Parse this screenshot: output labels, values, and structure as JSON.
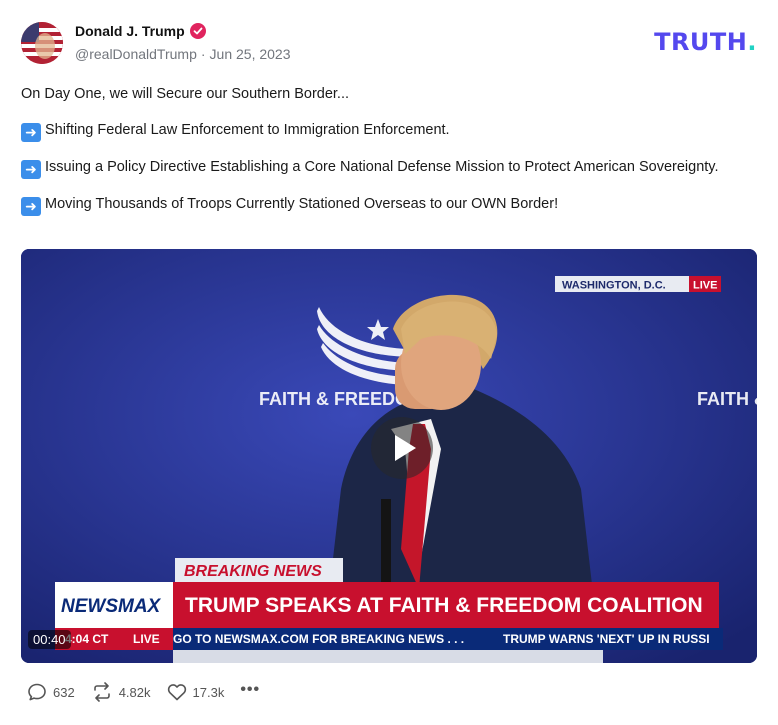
{
  "author": {
    "display_name": "Donald J. Trump",
    "handle": "@realDonaldTrump",
    "separator": "·",
    "date": "Jun 25, 2023"
  },
  "brand": {
    "name": "TRUTH",
    "dot": "."
  },
  "post": {
    "intro": "On Day One, we will Secure our Southern Border...",
    "items": [
      "Shifting Federal Law Enforcement to Immigration Enforcement.",
      "Issuing a Policy Directive Establishing a Core National Defense Mission to Protect American Sovereignty.",
      "Moving Thousands of Troops Currently Stationed Overseas to our OWN Border!"
    ]
  },
  "video": {
    "timestamp": "00:40",
    "location_bug": "WASHINGTON, D.C.",
    "live_bug": "LIVE",
    "backdrop_text": "FAITH & FREEDOM",
    "backdrop_text_right": "FAITH &",
    "breaking_label": "BREAKING NEWS",
    "network": "NEWSMAX",
    "headline": "TRUMP SPEAKS AT FAITH & FREEDOM COALITION",
    "clock": "4:04 CT",
    "ticker_live": "LIVE",
    "ticker_text": "GO TO NEWSMAX.COM FOR BREAKING NEWS . . .",
    "ticker_text_2": "TRUMP WARNS 'NEXT' UP IN RUSSI"
  },
  "stats": {
    "replies": "632",
    "retruths": "4.82k",
    "likes": "17.3k",
    "more": "•••"
  },
  "colors": {
    "brand": "#5448ee",
    "brand_dot": "#21d2c4",
    "verified": "#e0245e",
    "arrow_emoji": "#3b8eea",
    "newsmax_red": "#c8102e",
    "ticker_blue": "#0a2a78"
  }
}
